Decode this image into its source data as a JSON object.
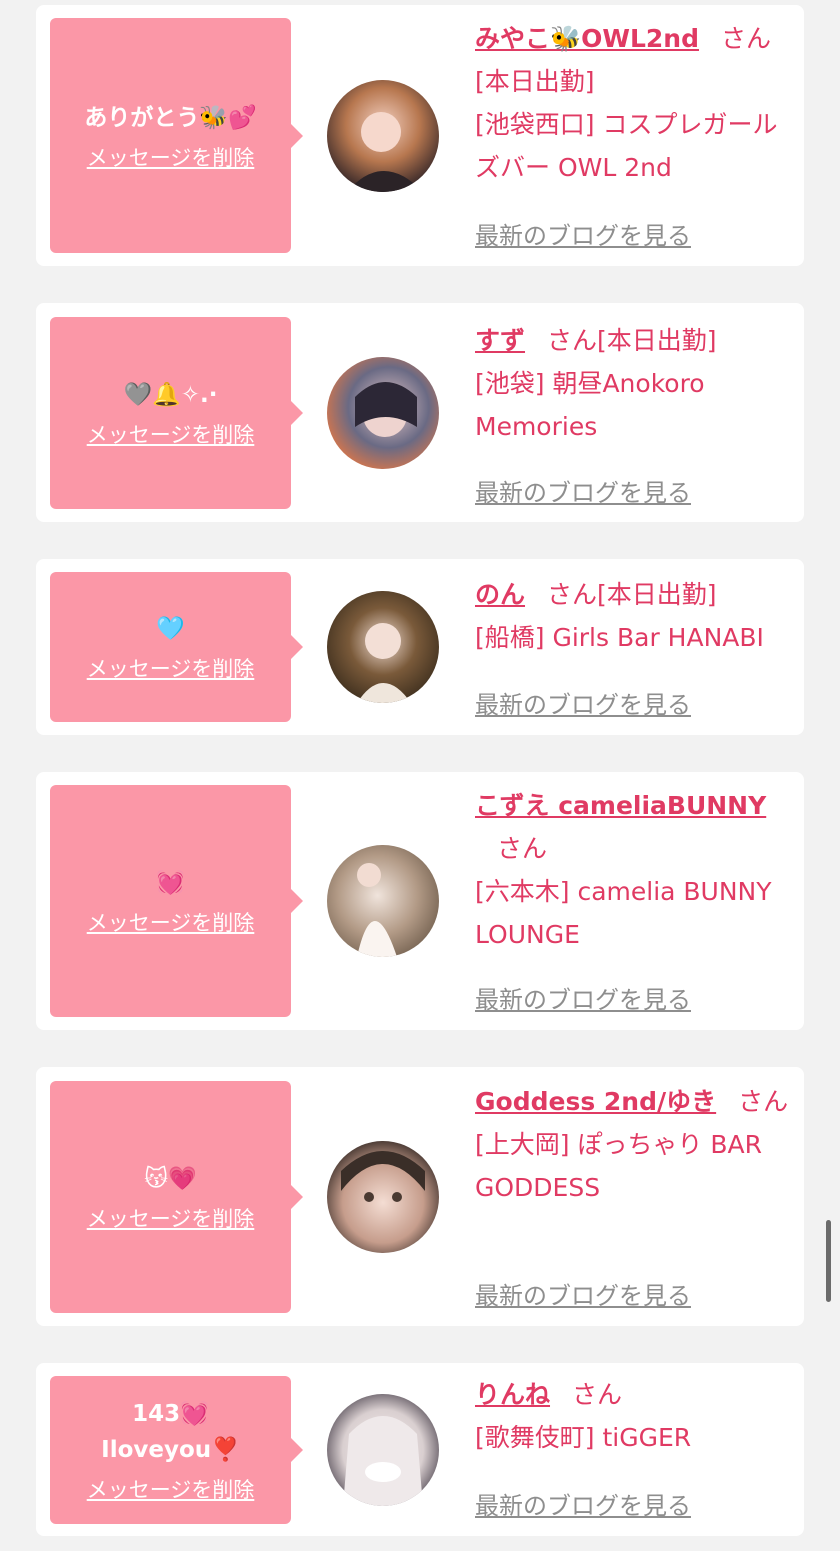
{
  "delete_label": "メッセージを削除",
  "blog_label": "最新のブログを見る",
  "san_label": "さん",
  "colors": {
    "page_bg": "#f2f2f2",
    "bubble": "#fb97a7",
    "accent": "#e03a63",
    "link_gray": "#8e8e8e"
  },
  "cards": [
    {
      "message": "ありがとう🐝💕",
      "name": "みやこ🐝OWL2nd",
      "status": "[本日出勤]",
      "shop": "[池袋西口] コスプレガールズバー OWL 2nd"
    },
    {
      "message": "🩶🔔✧.·",
      "name": "すず",
      "status": "[本日出勤]",
      "shop": "[池袋] 朝昼Anokoro Memories"
    },
    {
      "message": "🩵",
      "name": "のん",
      "status": "[本日出勤]",
      "shop": "[船橋] Girls Bar HANABI"
    },
    {
      "message": "💓",
      "name": "こずえ cameliaBUNNY",
      "status": "",
      "shop": "[六本木] camelia BUNNY LOUNGE"
    },
    {
      "message": "😽💗",
      "name": "Goddess 2nd/ゆき",
      "status": "",
      "shop": "[上大岡] ぽっちゃり BAR GODDESS"
    },
    {
      "message": "143💓\nIloveyou❣️",
      "name": "りんね",
      "status": "",
      "shop": "[歌舞伎町] tiGGER"
    }
  ]
}
